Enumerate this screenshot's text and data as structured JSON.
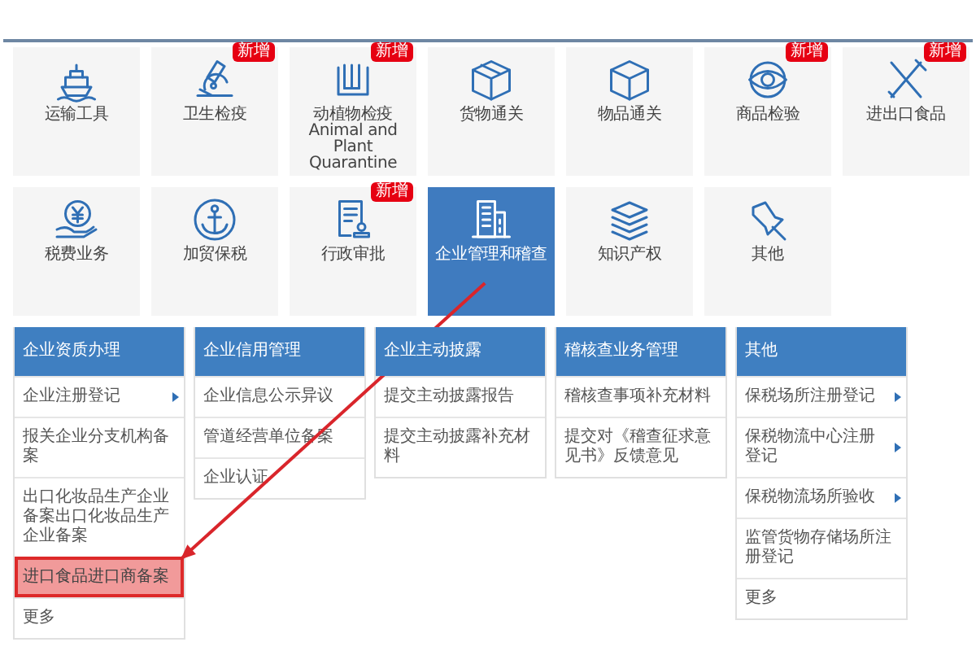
{
  "tiles": [
    {
      "label": "运输工具",
      "selected": false
    },
    {
      "label": "卫生检疫",
      "badge": "新增",
      "selected": false
    },
    {
      "label": "动植物检疫 Animal and Plant Quarantine",
      "badge": "新增",
      "selected": false
    },
    {
      "label": "货物通关",
      "selected": false
    },
    {
      "label": "物品通关",
      "selected": false
    },
    {
      "label": "商品检验",
      "badge": "新增",
      "selected": false
    },
    {
      "label": "进出口食品",
      "badge": "新增",
      "selected": false
    },
    {
      "label": "税费业务",
      "selected": false
    },
    {
      "label": "加贸保税",
      "selected": false
    },
    {
      "label": "行政审批",
      "badge": "新增",
      "selected": false
    },
    {
      "label": "企业管理和稽查",
      "selected": true
    },
    {
      "label": "知识产权",
      "selected": false
    },
    {
      "label": "其他",
      "selected": false
    }
  ],
  "menus": [
    {
      "title": "企业资质办理",
      "items": [
        {
          "label": "企业注册登记",
          "has_submenu": true,
          "highlighted": false
        },
        {
          "label": "报关企业分支机构备案",
          "has_submenu": false,
          "highlighted": false
        },
        {
          "label": "出口化妆品生产企业备案出口化妆品生产企业备案",
          "has_submenu": false,
          "highlighted": false
        },
        {
          "label": "进口食品进口商备案",
          "has_submenu": false,
          "highlighted": true
        },
        {
          "label": "更多",
          "has_submenu": false,
          "highlighted": false
        }
      ]
    },
    {
      "title": "企业信用管理",
      "items": [
        {
          "label": "企业信息公示异议",
          "has_submenu": false,
          "highlighted": false
        },
        {
          "label": "管道经营单位备案",
          "has_submenu": false,
          "highlighted": false
        },
        {
          "label": "企业认证",
          "has_submenu": false,
          "highlighted": false
        }
      ]
    },
    {
      "title": "企业主动披露",
      "items": [
        {
          "label": "提交主动披露报告",
          "has_submenu": false,
          "highlighted": false
        },
        {
          "label": "提交主动披露补充材料",
          "has_submenu": false,
          "highlighted": false
        }
      ]
    },
    {
      "title": "稽核查业务管理",
      "items": [
        {
          "label": "稽核查事项补充材料",
          "has_submenu": false,
          "highlighted": false
        },
        {
          "label": "提交对《稽查征求意见书》反馈意见",
          "has_submenu": false,
          "highlighted": false
        }
      ]
    },
    {
      "title": "其他",
      "items": [
        {
          "label": "保税场所注册登记",
          "has_submenu": true,
          "highlighted": false
        },
        {
          "label": "保税物流中心注册登记",
          "has_submenu": true,
          "highlighted": false
        },
        {
          "label": "保税物流场所验收",
          "has_submenu": true,
          "highlighted": false
        },
        {
          "label": "监管货物存储场所注册登记",
          "has_submenu": false,
          "highlighted": false
        },
        {
          "label": "更多",
          "has_submenu": false,
          "highlighted": false
        }
      ]
    }
  ]
}
